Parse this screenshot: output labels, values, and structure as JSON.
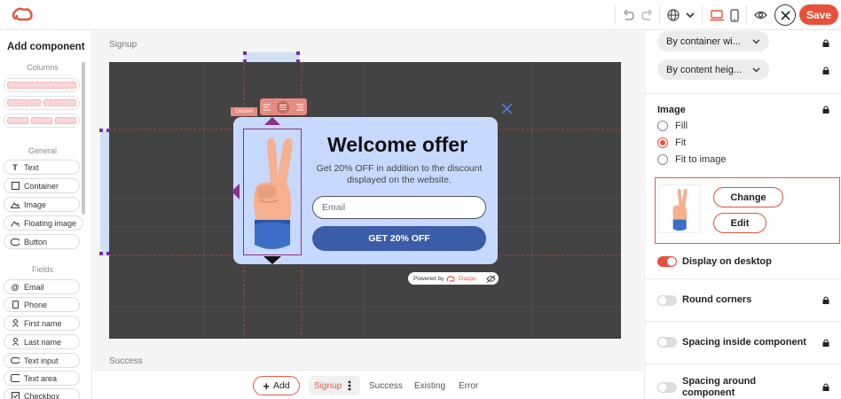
{
  "topbar": {
    "save_label": "Save"
  },
  "left_panel": {
    "title": "Add component",
    "sections": {
      "columns": "Columns",
      "general": "General",
      "fields": "Fields"
    },
    "general_items": [
      {
        "label": "Text",
        "icon": "text-icon"
      },
      {
        "label": "Container",
        "icon": "container-icon"
      },
      {
        "label": "Image",
        "icon": "image-icon"
      },
      {
        "label": "Floating image",
        "icon": "floating-image-icon"
      },
      {
        "label": "Button",
        "icon": "button-icon"
      }
    ],
    "field_items": [
      {
        "label": "Email",
        "icon": "at-icon"
      },
      {
        "label": "Phone",
        "icon": "phone-icon"
      },
      {
        "label": "First name",
        "icon": "person-icon"
      },
      {
        "label": "Last name",
        "icon": "person-icon"
      },
      {
        "label": "Text input",
        "icon": "text-input-icon"
      },
      {
        "label": "Text area",
        "icon": "text-area-icon"
      },
      {
        "label": "Checkbox",
        "icon": "checkbox-icon"
      }
    ]
  },
  "canvas": {
    "signup_label": "Signup",
    "success_label": "Success",
    "column_tag": "Column",
    "popup": {
      "title": "Welcome offer",
      "subtitle": "Get 20% OFF in addition to the discount displayed on the website.",
      "email_placeholder": "Email",
      "cta_label": "GET 20% OFF",
      "powered_by": "Powered by",
      "brand": "Claspo"
    }
  },
  "bottom_bar": {
    "add_label": "Add",
    "tabs": [
      "Signup",
      "Success",
      "Existing",
      "Error"
    ],
    "active_tab": "Signup"
  },
  "right_panel": {
    "width_dropdown": "By container wi...",
    "height_dropdown": "By content heig...",
    "image_section": "Image",
    "image_options": [
      "Fill",
      "Fit",
      "Fit to image"
    ],
    "selected_option": "Fit",
    "change_label": "Change",
    "edit_label": "Edit",
    "toggles": [
      {
        "label": "Display on desktop",
        "on": true
      },
      {
        "label": "Round corners",
        "on": false
      },
      {
        "label": "Spacing inside component",
        "on": false
      },
      {
        "label": "Spacing around component",
        "on": false
      }
    ]
  },
  "colors": {
    "accent": "#e7513a",
    "popup_bg": "#c8d9ff",
    "cta": "#3b5da8",
    "canvas_dark": "#434343"
  }
}
